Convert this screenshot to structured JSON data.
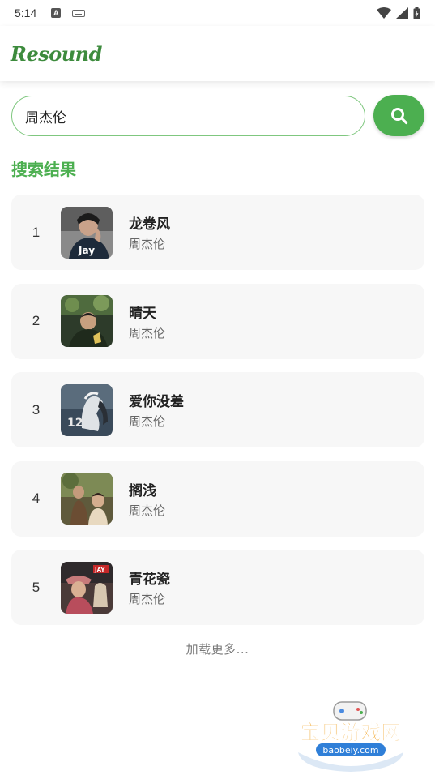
{
  "status_bar": {
    "time": "5:14"
  },
  "app": {
    "logo_text": "Resound",
    "brand_color": "#4caf50"
  },
  "search": {
    "value": "周杰伦",
    "placeholder": ""
  },
  "section": {
    "title": "搜索结果"
  },
  "results": [
    {
      "rank": "1",
      "title": "龙卷风",
      "artist": "周杰伦",
      "cover_text": "Jay"
    },
    {
      "rank": "2",
      "title": "晴天",
      "artist": "周杰伦",
      "cover_text": ""
    },
    {
      "rank": "3",
      "title": "爱你没差",
      "artist": "周杰伦",
      "cover_text": "12"
    },
    {
      "rank": "4",
      "title": "搁浅",
      "artist": "周杰伦",
      "cover_text": ""
    },
    {
      "rank": "5",
      "title": "青花瓷",
      "artist": "周杰伦",
      "cover_text": "JAY"
    }
  ],
  "load_more": "加载更多...",
  "watermark": {
    "text": "宝贝游戏网",
    "url_text": "baobeiy.com"
  },
  "icons": [
    "a-icon",
    "keyboard-icon",
    "wifi-icon",
    "signal-icon",
    "battery-icon",
    "search-icon"
  ]
}
